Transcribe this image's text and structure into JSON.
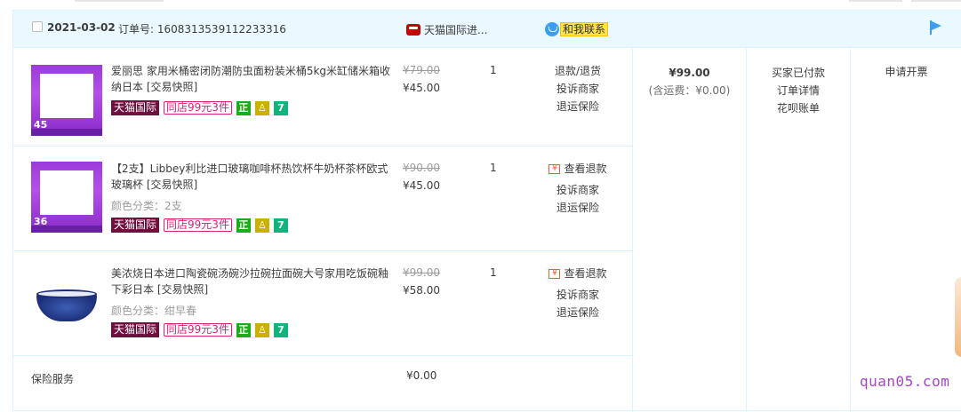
{
  "order": {
    "date": "2021-03-02",
    "order_no": "订单号: 1608313539112233316",
    "shop_name": "天猫国际进...",
    "contact_label": "和我联系",
    "total_amount": "¥99.00",
    "shipping_note": "(含运费：¥0.00)",
    "status": [
      "买家已付款",
      "订单详情",
      "花呗账单"
    ],
    "invoice_action": "申请开票"
  },
  "items": [
    {
      "title": "爱丽思 家用米桶密闭防潮防虫面粉装米桶5kg米缸储米箱收纳日本 [交易快照]",
      "spec": "",
      "original_price": "¥79.00",
      "price": "¥45.00",
      "quantity": "1",
      "ops": [
        "退款/退货",
        "投诉商家",
        "退运保险"
      ],
      "thumb_num": "45"
    },
    {
      "title": "【2支】Libbey利比进口玻璃咖啡杯热饮杯牛奶杯茶杯欧式玻璃杯 [交易快照]",
      "spec": "颜色分类：2支",
      "original_price": "¥90.00",
      "price": "¥45.00",
      "quantity": "1",
      "ops": [
        "查看退款",
        "投诉商家",
        "退运保险"
      ],
      "thumb_num": "36"
    },
    {
      "title": "美浓烧日本进口陶瓷碗汤碗沙拉碗拉面碗大号家用吃饭碗釉下彩日本 [交易快照]",
      "spec": "颜色分类：绀早春",
      "original_price": "¥99.00",
      "price": "¥58.00",
      "quantity": "1",
      "ops": [
        "查看退款",
        "投诉商家",
        "退运保险"
      ],
      "thumb_num": ""
    }
  ],
  "tags": {
    "tmall_intl": "天猫国际",
    "shop_promo": "同店99元3件",
    "zheng": "正"
  },
  "insurance": {
    "label": "保险服务",
    "price": "¥0.00"
  },
  "watermark": "quan05.com",
  "icons": [
    "checkbox-icon",
    "tmall-shop-icon",
    "wangwang-icon",
    "flag-icon",
    "refund-icon",
    "authentic-icon",
    "cup-icon",
    "seven-day-icon"
  ]
}
